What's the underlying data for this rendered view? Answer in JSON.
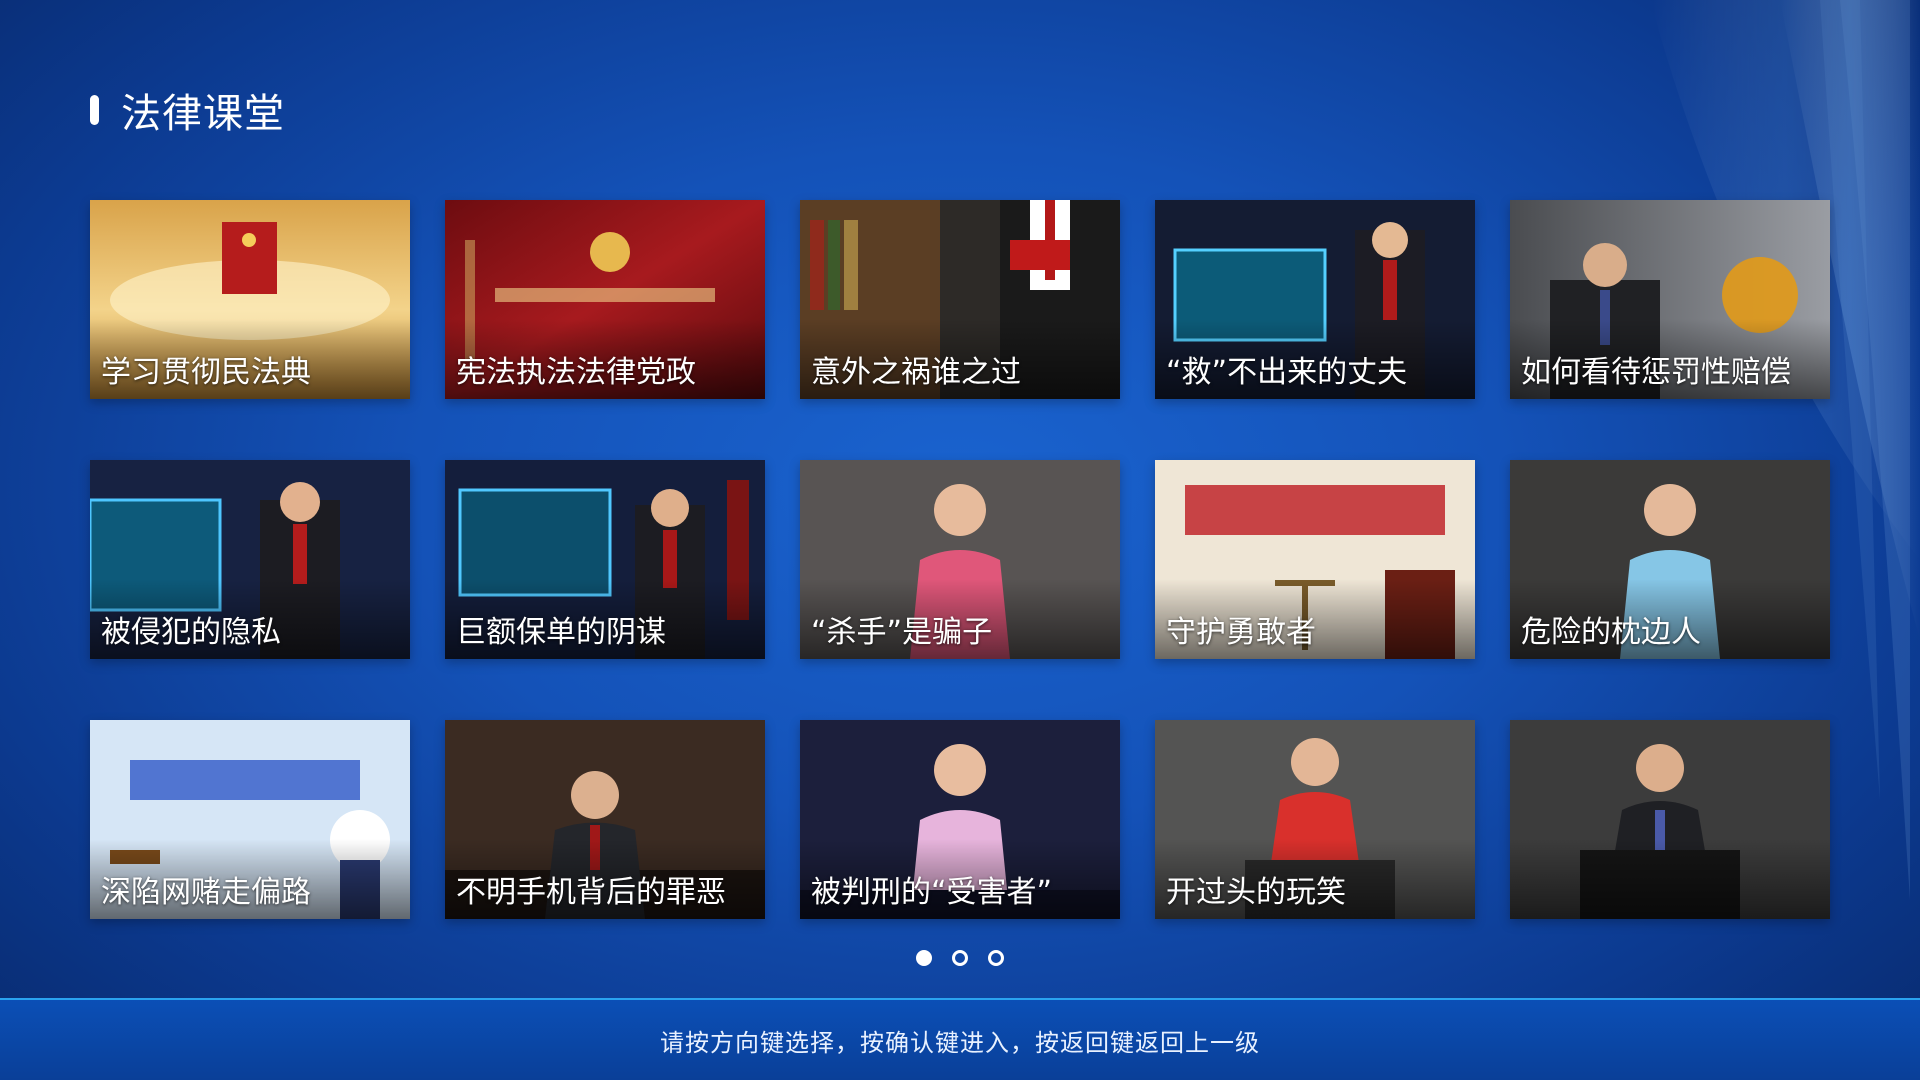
{
  "page": {
    "title": "法律课堂"
  },
  "videos": [
    {
      "title": "学习贯彻民法典",
      "thumb_icon": "civil-code-book-thumbnail",
      "bg": "#d7a24a"
    },
    {
      "title": "宪法执法法律党政",
      "thumb_icon": "prosecution-emblem-thumbnail",
      "bg": "#8a1418"
    },
    {
      "title": "意外之祸谁之过",
      "thumb_icon": "lawyer-reading-thumbnail",
      "bg": "#2d2a27"
    },
    {
      "title": "“救”不出来的丈夫",
      "thumb_icon": "host-studio-thumbnail",
      "bg": "#1e2a4a"
    },
    {
      "title": "如何看待惩罚性赔偿",
      "thumb_icon": "host-desk-thumbnail",
      "bg": "#606266"
    },
    {
      "title": "被侵犯的隐私",
      "thumb_icon": "host-studio-thumbnail",
      "bg": "#1f2b4f"
    },
    {
      "title": "巨额保单的阴谋",
      "thumb_icon": "host-studio-thumbnail",
      "bg": "#1b2747"
    },
    {
      "title": "“杀手”是骗子",
      "thumb_icon": "anchor-pink-thumbnail",
      "bg": "#4e4b49"
    },
    {
      "title": "守护勇敢者",
      "thumb_icon": "law-scales-thumbnail",
      "bg": "#efe6d6"
    },
    {
      "title": "危险的枕边人",
      "thumb_icon": "anchor-blue-thumbnail",
      "bg": "#3c3b3a"
    },
    {
      "title": "深陷网赌走偏路",
      "thumb_icon": "law-cartoon-police-thumbnail",
      "bg": "#cfe0f3"
    },
    {
      "title": "不明手机背后的罪恶",
      "thumb_icon": "host-desk-thumbnail",
      "bg": "#3b2b22"
    },
    {
      "title": "被判刑的“受害者”",
      "thumb_icon": "anchor-pink-thumbnail",
      "bg": "#1c1f3c"
    },
    {
      "title": "开过头的玩笑",
      "thumb_icon": "anchor-red-thumbnail",
      "bg": "#545453"
    },
    {
      "title": "",
      "thumb_icon": "host-podium-thumbnail",
      "bg": "#3c3c3c"
    }
  ],
  "pagination": {
    "total": 3,
    "current": 1
  },
  "footer": {
    "hint": "请按方向键选择，按确认键进入，按返回键返回上一级"
  },
  "colors": {
    "background": "#1452b8",
    "footer": "#0a3f98",
    "footer_border": "#2aa3f0"
  }
}
